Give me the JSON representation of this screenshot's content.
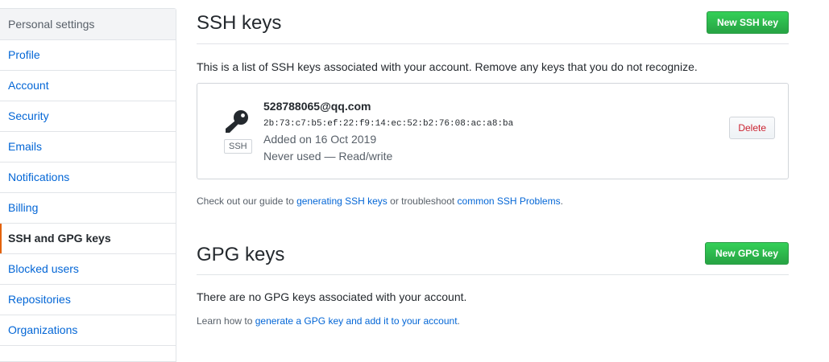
{
  "sidebar": {
    "header": "Personal settings",
    "items": [
      {
        "label": "Profile"
      },
      {
        "label": "Account"
      },
      {
        "label": "Security"
      },
      {
        "label": "Emails"
      },
      {
        "label": "Notifications"
      },
      {
        "label": "Billing"
      },
      {
        "label": "SSH and GPG keys",
        "selected": true
      },
      {
        "label": "Blocked users"
      },
      {
        "label": "Repositories"
      },
      {
        "label": "Organizations"
      }
    ]
  },
  "ssh": {
    "title": "SSH keys",
    "new_button": "New SSH key",
    "intro": "This is a list of SSH keys associated with your account. Remove any keys that you do not recognize.",
    "key": {
      "icon": "key-icon",
      "badge": "SSH",
      "title": "528788065@qq.com",
      "fingerprint": "2b:73:c7:b5:ef:22:f9:14:ec:52:b2:76:08:ac:a8:ba",
      "added": "Added on 16 Oct 2019",
      "usage": "Never used — Read/write",
      "delete_button": "Delete"
    },
    "note": {
      "prefix": "Check out our guide to ",
      "link1": "generating SSH keys",
      "middle": " or troubleshoot ",
      "link2": "common SSH Problems",
      "suffix": "."
    }
  },
  "gpg": {
    "title": "GPG keys",
    "new_button": "New GPG key",
    "empty": "There are no GPG keys associated with your account.",
    "note": {
      "prefix": "Learn how to ",
      "link": "generate a GPG key and add it to your account",
      "suffix": "."
    }
  },
  "colors": {
    "link": "#0366d6",
    "primary": "#28a745",
    "danger": "#cb2431",
    "selected_marker": "#e36209"
  }
}
